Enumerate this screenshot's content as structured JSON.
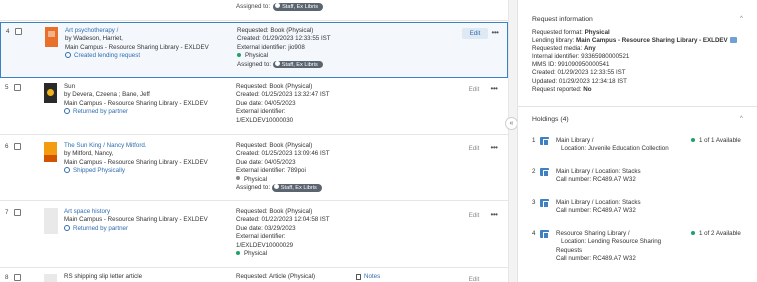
{
  "top": {
    "assigned_label": "Assigned to:",
    "assignee": "Staff, Ex Libris"
  },
  "rows": [
    {
      "num": "4",
      "title": "Art psychotherapy /",
      "author": "by Wadeson, Harriet,",
      "library": "Main Campus - Resource Sharing Library - EXLDEV",
      "status": "Created lending request",
      "details": [
        "Requested: Book (Physical)",
        "Created: 01/29/2023 12:33:55 IST",
        "External identifier: jio908"
      ],
      "format": "Physical",
      "assigned_label": "Assigned to:",
      "assignee": "Staff, Ex Libris",
      "edit": "Edit"
    },
    {
      "num": "5",
      "title": "Sun",
      "author": "by Devera, Czeena ; Bane, Jeff",
      "library": "Main Campus - Resource Sharing Library - EXLDEV",
      "status": "Returned by partner",
      "details": [
        "Requested: Book (Physical)",
        "Created: 01/25/2023 13:32:47 IST",
        "Due date: 04/05/2023",
        "External identifier:",
        "1/EXLDEV10000030"
      ],
      "edit": "Edit"
    },
    {
      "num": "6",
      "title": "The Sun King / Nancy Mitford.",
      "author": "by Mitford, Nancy,",
      "library": "Main Campus - Resource Sharing Library - EXLDEV",
      "status": "Shipped Physically",
      "details": [
        "Requested: Book (Physical)",
        "Created: 01/25/2023 13:09:46 IST",
        "Due date: 04/05/2023",
        "External identifier: 789poi"
      ],
      "format": "Physical",
      "assigned_label": "Assigned to:",
      "assignee": "Staff, Ex Libris",
      "edit": "Edit"
    },
    {
      "num": "7",
      "title": "Art space history",
      "library": "Main Campus - Resource Sharing Library - EXLDEV",
      "status": "Returned by partner",
      "details": [
        "Requested: Book (Physical)",
        "Created: 01/22/2023 12:04:58 IST",
        "Due date: 03/29/2023",
        "External identifier:",
        "1/EXLDEV10000029"
      ],
      "format": "Physical",
      "edit": "Edit"
    },
    {
      "num": "8",
      "title": "RS shipping slip letter article",
      "details": [
        "Requested: Article (Physical)"
      ],
      "notes": "Notes",
      "edit": "Edit"
    }
  ],
  "request_info": {
    "heading": "Request information",
    "requested_format_label": "Requested format:",
    "requested_format": "Physical",
    "lending_library_label": "Lending library:",
    "lending_library": "Main Campus - Resource Sharing Library - EXLDEV",
    "requested_media_label": "Requested media:",
    "requested_media": "Any",
    "internal_id": "Internal identifier: 93365980000521",
    "mms_id": "MMS ID: 991090950000541",
    "created": "Created: 01/29/2023 12:33:55 IST",
    "updated": "Updated: 01/29/2023 12:34:18 IST",
    "reported_label": "Request reported:",
    "reported": "No"
  },
  "holdings": {
    "heading": "Holdings (4)",
    "items": [
      {
        "num": "1",
        "library": "Main Library",
        "location": "Location: Juvenile Education Collection",
        "availability": "1 of 1 Available"
      },
      {
        "num": "2",
        "library": "Main Library",
        "location": "Location: Stacks",
        "call": "Call number: RC489.A7 W32"
      },
      {
        "num": "3",
        "library": "Main Library",
        "location": "Location: Stacks",
        "call": "Call number: RC489.A7 W32"
      },
      {
        "num": "4",
        "library": "Resource Sharing Library",
        "location": "Location: Lending Resource Sharing",
        "location2": "Requests",
        "call": "Call number: RC489.A7 W32",
        "availability": "1 of 2 Available"
      }
    ]
  },
  "colors": {
    "accent": "#2f6db0",
    "selected_border": "#3b82c4",
    "available": "#22a06b",
    "chip": "#5b6570"
  }
}
